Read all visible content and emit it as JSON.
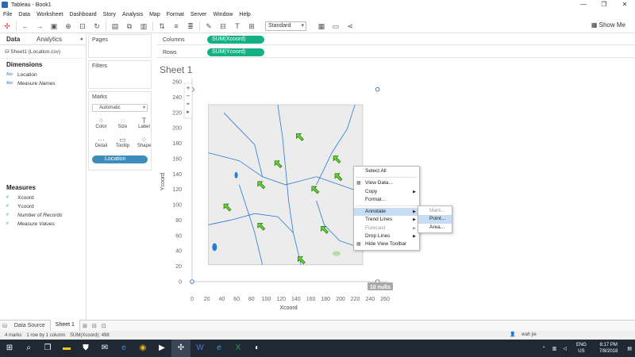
{
  "window": {
    "title": "Tableau - Book1",
    "controls": [
      "—",
      "❐",
      "✕"
    ]
  },
  "menu": [
    "File",
    "Data",
    "Worksheet",
    "Dashboard",
    "Story",
    "Analysis",
    "Map",
    "Format",
    "Server",
    "Window",
    "Help"
  ],
  "toolbar": {
    "view_size": "Standard",
    "show_me": "Show Me"
  },
  "data_pane": {
    "tabs": [
      "Data",
      "Analytics"
    ],
    "datasource": "Sheet1 (Location.csv)",
    "dimensions_title": "Dimensions",
    "dimensions": [
      {
        "type": "Abc",
        "name": "Location",
        "italic": false
      },
      {
        "type": "Abc",
        "name": "Measure Names",
        "italic": true
      }
    ],
    "measures_title": "Measures",
    "measures": [
      {
        "type": "#",
        "name": "Xcoord",
        "italic": false
      },
      {
        "type": "#",
        "name": "Ycoord",
        "italic": false
      },
      {
        "type": "#",
        "name": "Number of Records",
        "italic": true
      },
      {
        "type": "#",
        "name": "Measure Values",
        "italic": true
      }
    ]
  },
  "cards": {
    "pages": "Pages",
    "filters": "Filters",
    "marks": "Marks",
    "mark_type": "Automatic",
    "mark_buttons": [
      {
        "glyph": "⁘",
        "label": "Color"
      },
      {
        "glyph": "◌",
        "label": "Size"
      },
      {
        "glyph": "T",
        "label": "Label"
      },
      {
        "glyph": "⋯",
        "label": "Detail"
      },
      {
        "glyph": "▭",
        "label": "Tooltip"
      },
      {
        "glyph": "⁘",
        "label": "Shape"
      }
    ],
    "detail_pill": "Location"
  },
  "shelves": {
    "columns_label": "Columns",
    "columns_pill": "SUM(Xcoord)",
    "rows_label": "Rows",
    "rows_pill": "SUM(Ycoord)"
  },
  "sheet": {
    "title": "Sheet 1",
    "nulls_badge": "10 nulls"
  },
  "chart_data": {
    "type": "scatter",
    "xlabel": "Xcoord",
    "ylabel": "Ycoord",
    "xlim": [
      0,
      260
    ],
    "ylim": [
      0,
      260
    ],
    "xticks": [
      0,
      20,
      40,
      60,
      80,
      100,
      120,
      140,
      160,
      180,
      200,
      220,
      240,
      260
    ],
    "yticks": [
      0,
      20,
      40,
      60,
      80,
      100,
      120,
      140,
      160,
      180,
      200,
      220,
      240,
      260
    ],
    "points": [
      {
        "x": 0,
        "y": 0
      },
      {
        "x": 0,
        "y": 250
      },
      {
        "x": 250,
        "y": 250
      },
      {
        "x": 250,
        "y": 0
      }
    ],
    "background_image": {
      "x_range": [
        22,
        230
      ],
      "y_range": [
        22,
        230
      ]
    }
  },
  "context_menu": {
    "items": [
      {
        "label": "Select All",
        "icon": "",
        "submenu": false,
        "disabled": false,
        "highlight": false
      },
      {
        "sep": true
      },
      {
        "label": "View Data...",
        "icon": "▦",
        "submenu": false,
        "disabled": false,
        "highlight": false
      },
      {
        "label": "Copy",
        "icon": "",
        "submenu": true,
        "disabled": false,
        "highlight": false
      },
      {
        "label": "Format...",
        "icon": "",
        "submenu": false,
        "disabled": false,
        "highlight": false
      },
      {
        "sep": true
      },
      {
        "label": "Annotate",
        "icon": "",
        "submenu": true,
        "disabled": false,
        "highlight": true
      },
      {
        "label": "Trend Lines",
        "icon": "",
        "submenu": true,
        "disabled": false,
        "highlight": false
      },
      {
        "label": "Forecast",
        "icon": "",
        "submenu": true,
        "disabled": true,
        "highlight": false
      },
      {
        "label": "Drop Lines",
        "icon": "",
        "submenu": true,
        "disabled": false,
        "highlight": false
      },
      {
        "label": "Hide View Toolbar",
        "icon": "▦",
        "submenu": false,
        "disabled": false,
        "highlight": false
      }
    ],
    "submenu": [
      {
        "label": "Mark...",
        "disabled": true,
        "highlight": false
      },
      {
        "label": "Point...",
        "disabled": false,
        "highlight": true
      },
      {
        "label": "Area...",
        "disabled": false,
        "highlight": false
      }
    ]
  },
  "bottom_tabs": {
    "data_source": "Data Source",
    "sheet": "Sheet 1"
  },
  "status": {
    "marks": "4 marks",
    "rows_cols": "1 row by 1 column",
    "sum": "SUM(Xcoord): 498",
    "user": "wah jie"
  },
  "taskbar": {
    "lang": "ENG",
    "region": "US",
    "time": "8:17 PM",
    "date": "7/8/2018"
  },
  "colors": {
    "accent_green": "#12b083",
    "pill_blue": "#3c8dbc",
    "map_water": "#2a7bd4"
  }
}
